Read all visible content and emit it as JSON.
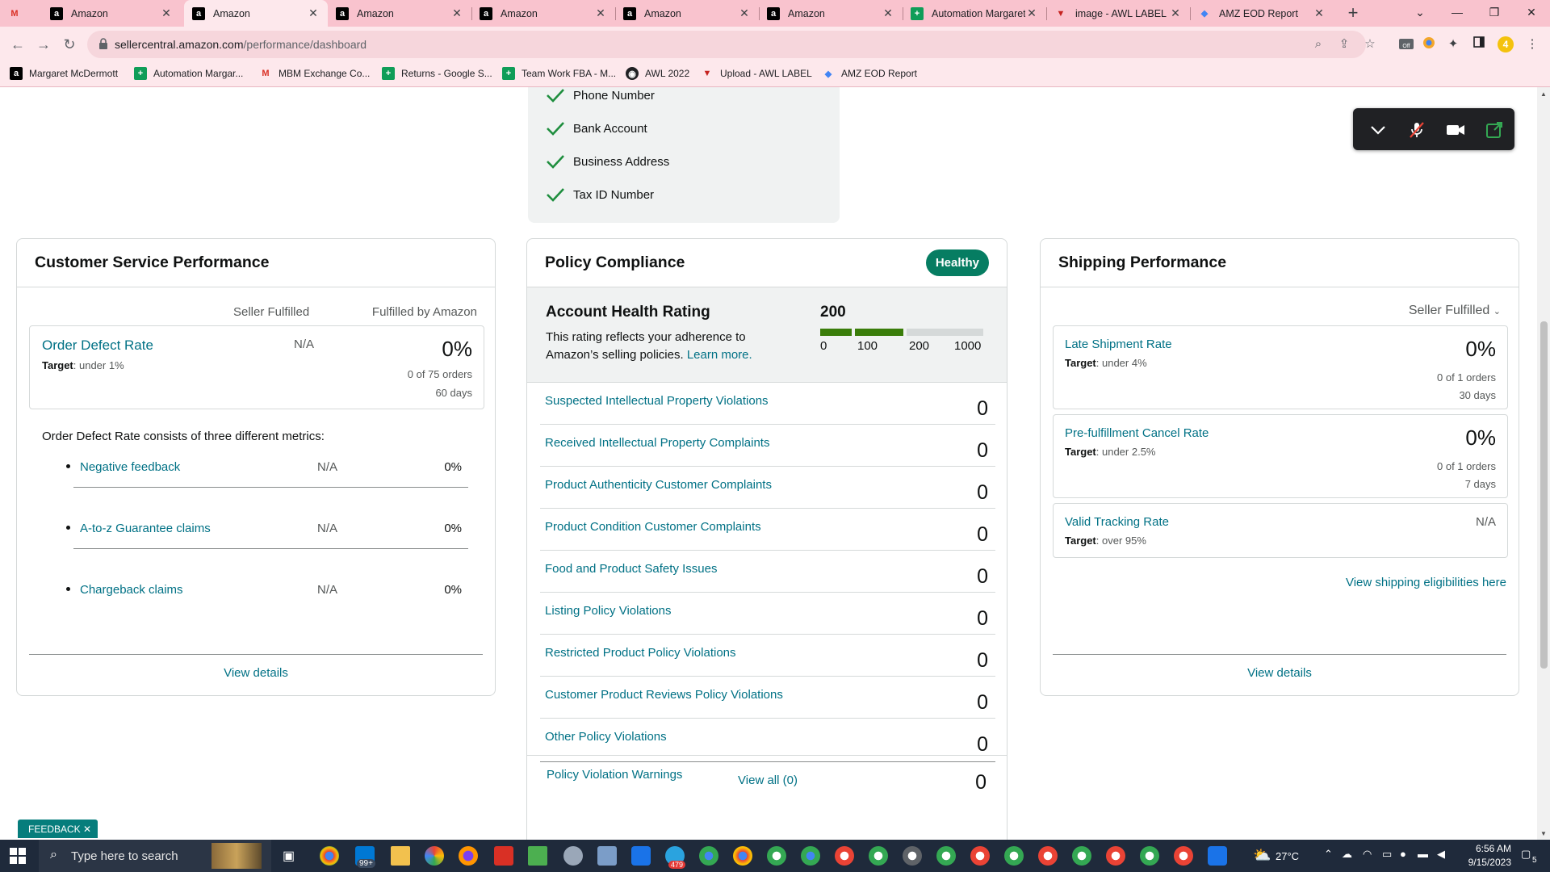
{
  "browser": {
    "tabs": [
      {
        "title": "",
        "icon": "gmail-icon"
      },
      {
        "title": "Amazon",
        "icon": "amazon-icon"
      },
      {
        "title": "Amazon",
        "icon": "amazon-icon",
        "active": true
      },
      {
        "title": "Amazon",
        "icon": "amazon-icon"
      },
      {
        "title": "Amazon",
        "icon": "amazon-icon"
      },
      {
        "title": "Amazon",
        "icon": "amazon-icon"
      },
      {
        "title": "Amazon",
        "icon": "amazon-icon"
      },
      {
        "title": "Automation Margaret",
        "icon": "sheets-icon"
      },
      {
        "title": "image - AWL LABEL",
        "icon": "awl-icon"
      },
      {
        "title": "AMZ EOD Report",
        "icon": "amz-eod-icon"
      }
    ],
    "url_host": "sellercentral.amazon.com",
    "url_path": "/performance/dashboard",
    "bookmarks": [
      {
        "label": "Margaret McDermott",
        "icon": "amazon-icon"
      },
      {
        "label": "Automation Margar...",
        "icon": "sheets-icon"
      },
      {
        "label": "MBM Exchange Co...",
        "icon": "gmail-icon"
      },
      {
        "label": "Returns - Google S...",
        "icon": "sheets-icon"
      },
      {
        "label": "Team Work FBA - M...",
        "icon": "sheets-icon"
      },
      {
        "label": "AWL 2022",
        "icon": "globe-icon"
      },
      {
        "label": "Upload - AWL LABEL",
        "icon": "awl-icon"
      },
      {
        "label": "AMZ EOD Report",
        "icon": "amz-eod-icon"
      }
    ],
    "extension_badge": "4",
    "extension_off_label": "Off"
  },
  "verification": {
    "items": [
      "Phone Number",
      "Bank Account",
      "Business Address",
      "Tax ID Number"
    ]
  },
  "customer_service": {
    "title": "Customer Service Performance",
    "col_seller": "Seller Fulfilled",
    "col_fba": "Fulfilled by Amazon",
    "odr_name": "Order Defect Rate",
    "odr_target_label": "Target",
    "odr_target": ": under 1%",
    "odr_seller": "N/A",
    "odr_value": "0%",
    "odr_orders": "0 of 75 orders",
    "odr_days": "60 days",
    "consists_text": "Order Defect Rate consists of three different metrics:",
    "metrics": [
      {
        "name": "Negative feedback",
        "seller": "N/A",
        "fba": "0%"
      },
      {
        "name": "A-to-z Guarantee claims",
        "seller": "N/A",
        "fba": "0%"
      },
      {
        "name": "Chargeback claims",
        "seller": "N/A",
        "fba": "0%"
      }
    ],
    "view_details": "View details"
  },
  "policy": {
    "title": "Policy Compliance",
    "badge": "Healthy",
    "ahr_title": "Account Health Rating",
    "ahr_desc": "This rating reflects your adherence to Amazon’s selling policies.",
    "ahr_learn": "Learn more.",
    "ahr_score": "200",
    "ahr_ticks": [
      "0",
      "100",
      "200",
      "1000"
    ],
    "rows": [
      {
        "name": "Suspected Intellectual Property Violations",
        "value": "0"
      },
      {
        "name": "Received Intellectual Property Complaints",
        "value": "0"
      },
      {
        "name": "Product Authenticity Customer Complaints",
        "value": "0"
      },
      {
        "name": "Product Condition Customer Complaints",
        "value": "0"
      },
      {
        "name": "Food and Product Safety Issues",
        "value": "0"
      },
      {
        "name": "Listing Policy Violations",
        "value": "0"
      },
      {
        "name": "Restricted Product Policy Violations",
        "value": "0"
      },
      {
        "name": "Customer Product Reviews Policy Violations",
        "value": "0"
      },
      {
        "name": "Other Policy Violations",
        "value": "0"
      }
    ],
    "view_all": "View all (0)",
    "warnings_label": "Policy Violation Warnings",
    "warnings_value": "0"
  },
  "shipping": {
    "title": "Shipping Performance",
    "filter": "Seller Fulfilled",
    "metrics": [
      {
        "name": "Late Shipment Rate",
        "target_label": "Target",
        "target": ": under 4%",
        "value": "0%",
        "orders": "0 of 1 orders",
        "days": "30 days"
      },
      {
        "name": "Pre-fulfillment Cancel Rate",
        "target_label": "Target",
        "target": ": under 2.5%",
        "value": "0%",
        "orders": "0 of 1 orders",
        "days": "7 days"
      },
      {
        "name": "Valid Tracking Rate",
        "target_label": "Target",
        "target": ": over 95%",
        "value": "N/A"
      }
    ],
    "eligibility_link": "View shipping eligibilities here",
    "view_details": "View details"
  },
  "feedback_label": "FEEDBACK",
  "taskbar": {
    "search_placeholder": "Type here to search",
    "mail_badge": "99+",
    "telegram_badge": "479",
    "weather": "27°C",
    "time": "6:56 AM",
    "date": "9/15/2023",
    "notification_count": "5"
  },
  "colors": {
    "amazon_link": "#007185",
    "healthy_green": "#067d62",
    "ahr_bar_green": "#3a7d0a",
    "tab_strip_pink": "#f9c3ce"
  }
}
